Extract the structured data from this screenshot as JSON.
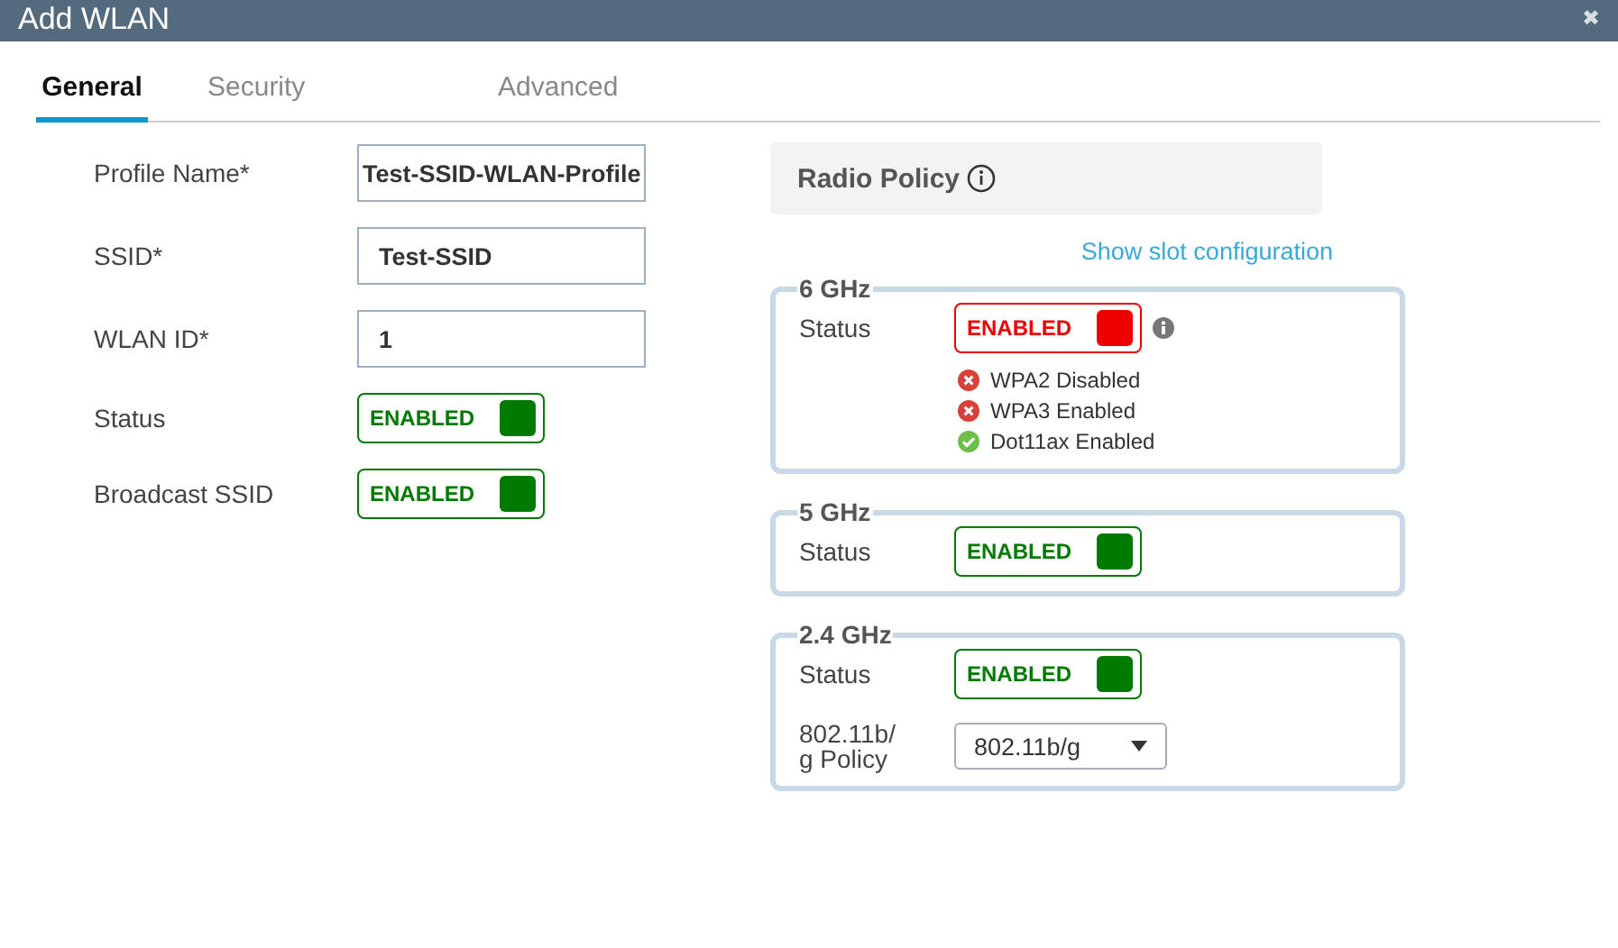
{
  "window": {
    "title": "Add WLAN",
    "close": "✖"
  },
  "tabs": [
    {
      "label": "General",
      "selected": true
    },
    {
      "label": "Security",
      "selected": false
    },
    {
      "label": "Advanced",
      "selected": false
    }
  ],
  "general": {
    "fields": [
      {
        "kind": "text",
        "label": "Profile Name*",
        "value": "Test-SSID-WLAN-Profile"
      },
      {
        "kind": "text",
        "label": "SSID*",
        "value": "Test-SSID"
      },
      {
        "kind": "text",
        "label": "WLAN ID*",
        "value": "1"
      },
      {
        "kind": "toggle",
        "label": "Status",
        "toggle": {
          "label": "ENABLED",
          "on": true,
          "kind": "ok"
        }
      },
      {
        "kind": "toggle",
        "label": "Broadcast SSID",
        "toggle": {
          "label": "ENABLED",
          "on": true,
          "kind": "ok"
        }
      }
    ]
  },
  "radio_policy": {
    "title": "Radio Policy",
    "link": "Show slot configuration",
    "bands": [
      {
        "name": "6 GHz",
        "status_label": "Status",
        "toggle": {
          "label": "ENABLED",
          "on": true,
          "kind": "error"
        },
        "info": true,
        "checks": [
          {
            "label": "WPA2 Disabled",
            "passed": false
          },
          {
            "label": "WPA3 Enabled",
            "passed": false
          },
          {
            "label": "Dot11ax Enabled",
            "passed": true
          }
        ]
      },
      {
        "name": "5 GHz",
        "status_label": "Status",
        "toggle": {
          "label": "ENABLED",
          "on": true,
          "kind": "ok"
        }
      },
      {
        "name": "2.4 GHz",
        "status_label": "Status",
        "toggle": {
          "label": "ENABLED",
          "on": true,
          "kind": "ok"
        },
        "policy": {
          "label": "802.11b/\ng Policy",
          "value": "802.11b/g"
        }
      }
    ]
  }
}
